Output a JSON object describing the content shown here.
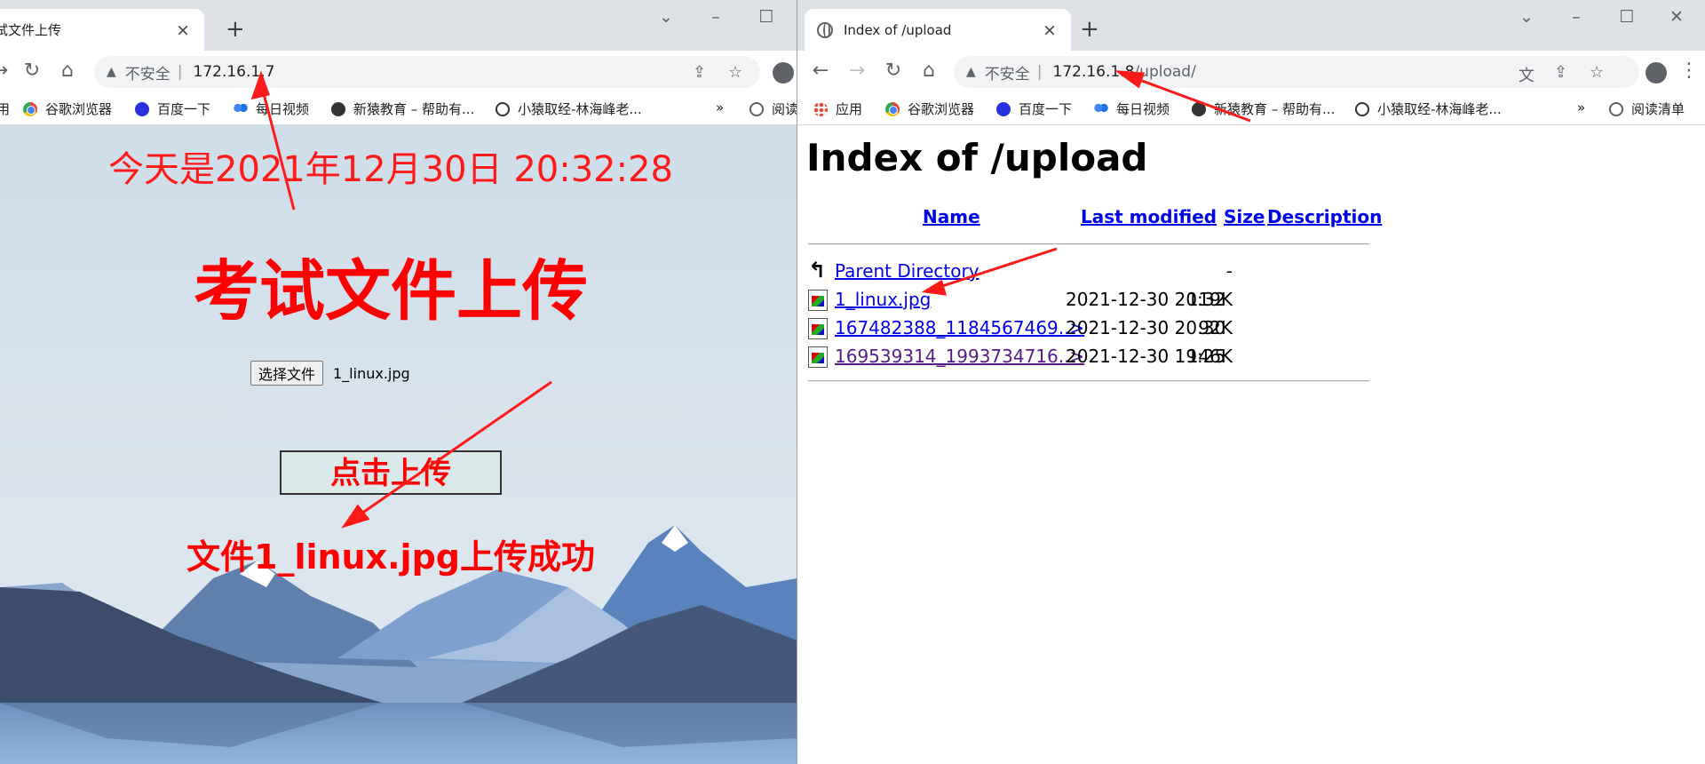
{
  "left_window": {
    "tab_title": "试文件上传",
    "address": {
      "not_secure": "不安全",
      "url": "172.16.1.7"
    },
    "bookmarks": [
      "用",
      "谷歌浏览器",
      "百度一下",
      "每日视频",
      "新猿教育 – 帮助有...",
      "小猿取经-林海峰老...",
      "»",
      "阅读"
    ],
    "page": {
      "datetime": "今天是2021年12月30日 20:32:28",
      "title": "考试文件上传",
      "choose_file_label": "选择文件",
      "chosen_file": "1_linux.jpg",
      "upload_button": "点击上传",
      "success_message": "文件1_linux.jpg上传成功"
    }
  },
  "right_window": {
    "tab_title": "Index of /upload",
    "address": {
      "not_secure": "不安全",
      "host": "172.16.1.8",
      "path": "/upload/"
    },
    "bookmarks": [
      "应用",
      "谷歌浏览器",
      "百度一下",
      "每日视频",
      "新猿教育 – 帮助有...",
      "小猿取经-林海峰老...",
      "»",
      "阅读清单"
    ],
    "page": {
      "heading": "Index of /upload",
      "columns": [
        "Name",
        "Last modified",
        "Size",
        "Description"
      ],
      "rows": [
        {
          "name": "Parent Directory",
          "date": "",
          "size": "-",
          "icon": "back-icon"
        },
        {
          "name": "1_linux.jpg",
          "date": "2021-12-30 20:32",
          "size": "119K",
          "icon": "image-file-icon"
        },
        {
          "name": "167482388_1184567469..>",
          "date": "2021-12-30 20:30",
          "size": "92K",
          "icon": "image-file-icon"
        },
        {
          "name": "169539314_1993734716..>",
          "date": "2021-12-30 19:25",
          "size": "146K",
          "icon": "image-file-icon"
        }
      ]
    }
  },
  "colors": {
    "annotation_arrow": "#ff1a1a",
    "link": "#0000ee",
    "visited_link": "#551a8b",
    "page_bg": "#d3e0ec"
  }
}
